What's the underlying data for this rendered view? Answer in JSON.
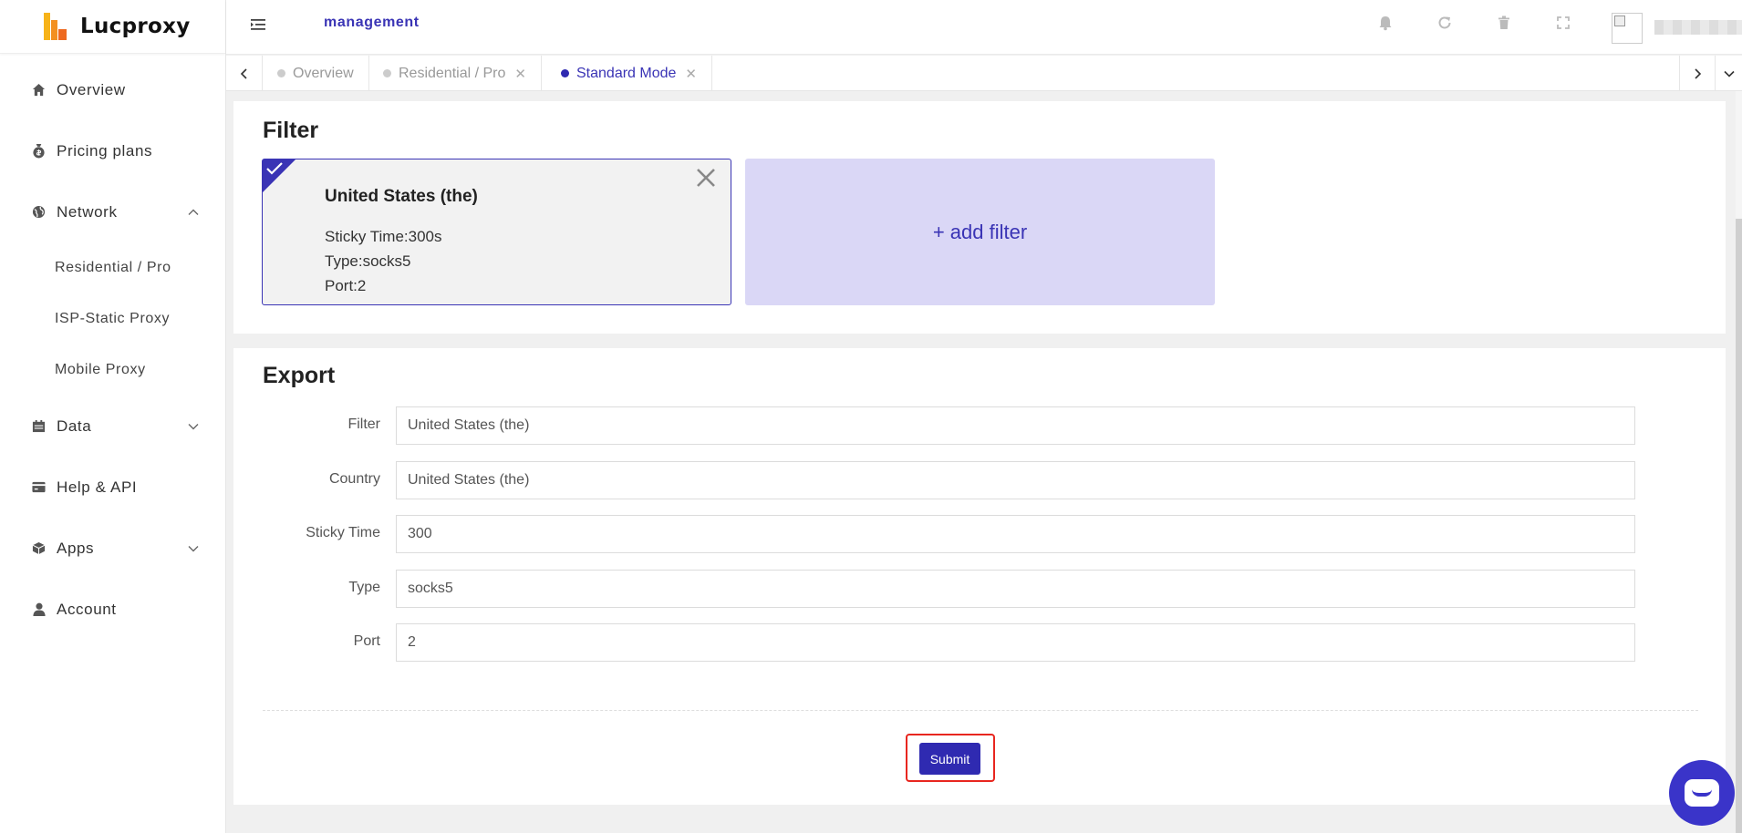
{
  "brand": {
    "name": "Lucproxy"
  },
  "sidebar": {
    "items": [
      {
        "label": "Overview",
        "icon": "home-icon"
      },
      {
        "label": "Pricing plans",
        "icon": "money-bag-icon"
      },
      {
        "label": "Network",
        "icon": "globe-icon",
        "expanded": true,
        "children": [
          {
            "label": "Residential / Pro"
          },
          {
            "label": "ISP-Static Proxy"
          },
          {
            "label": "Mobile Proxy"
          }
        ]
      },
      {
        "label": "Data",
        "icon": "calendar-icon",
        "expanded": false
      },
      {
        "label": "Help & API",
        "icon": "card-icon"
      },
      {
        "label": "Apps",
        "icon": "cube-icon",
        "expanded": false
      },
      {
        "label": "Account",
        "icon": "user-icon"
      }
    ]
  },
  "header": {
    "title": "management",
    "icons": [
      "bell-icon",
      "refresh-icon",
      "trash-icon",
      "fullscreen-icon"
    ]
  },
  "tabs": [
    {
      "label": "Overview",
      "active": false,
      "closable": false
    },
    {
      "label": "Residential / Pro",
      "active": false,
      "closable": true
    },
    {
      "label": "Standard Mode",
      "active": true,
      "closable": true
    }
  ],
  "filter_section": {
    "title": "Filter",
    "selected_filter": {
      "name": "United States (the)",
      "lines": [
        "Sticky Time:300s",
        "Type:socks5",
        "Port:2"
      ]
    },
    "add_label": "+ add filter"
  },
  "export_section": {
    "title": "Export",
    "fields": [
      {
        "label": "Filter",
        "value": "United States (the)"
      },
      {
        "label": "Country",
        "value": "United States (the)"
      },
      {
        "label": "Sticky Time",
        "value": "300"
      },
      {
        "label": "Type",
        "value": "socks5"
      },
      {
        "label": "Port",
        "value": "2"
      }
    ],
    "submit_label": "Submit"
  },
  "colors": {
    "accent": "#2f2ab1",
    "accent_light": "#dad7f6",
    "highlight": "#e8261f"
  }
}
